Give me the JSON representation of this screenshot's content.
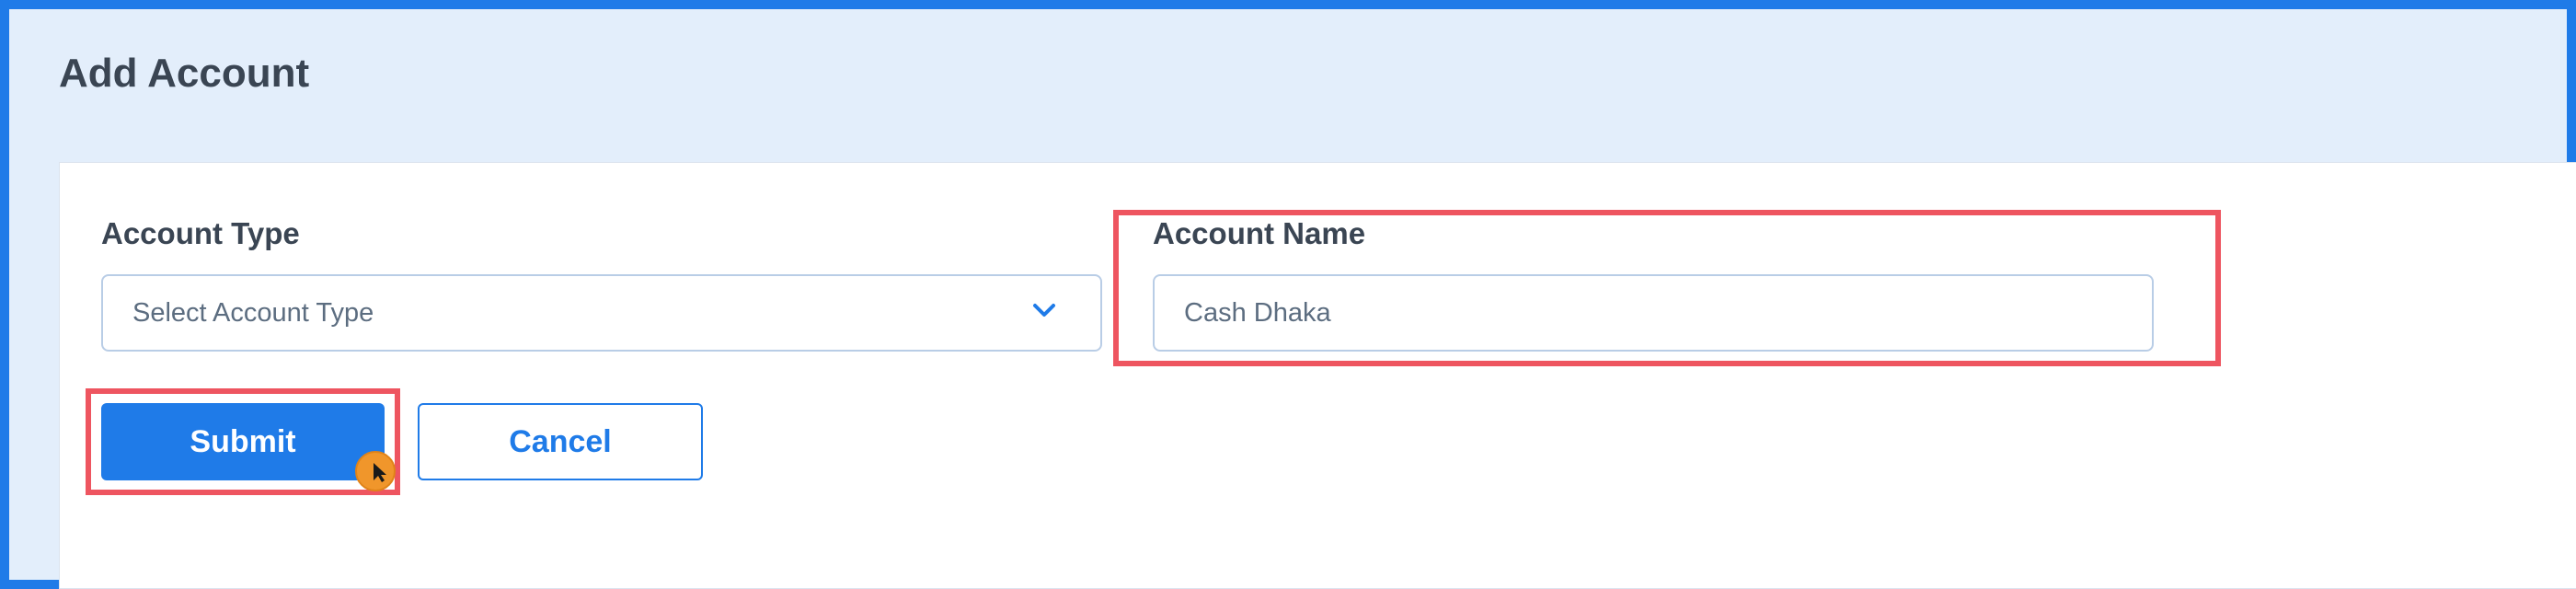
{
  "header": {
    "title": "Add Account"
  },
  "form": {
    "account_type": {
      "label": "Account Type",
      "placeholder": "Select Account Type",
      "chevron_icon": "chevron-down-icon"
    },
    "account_name": {
      "label": "Account Name",
      "value": "Cash Dhaka"
    },
    "submit_label": "Submit",
    "cancel_label": "Cancel"
  },
  "colors": {
    "accent": "#1f7be8",
    "highlight": "#ee5560",
    "header_bg": "#e3eefb",
    "cursor": "#f0962b"
  }
}
